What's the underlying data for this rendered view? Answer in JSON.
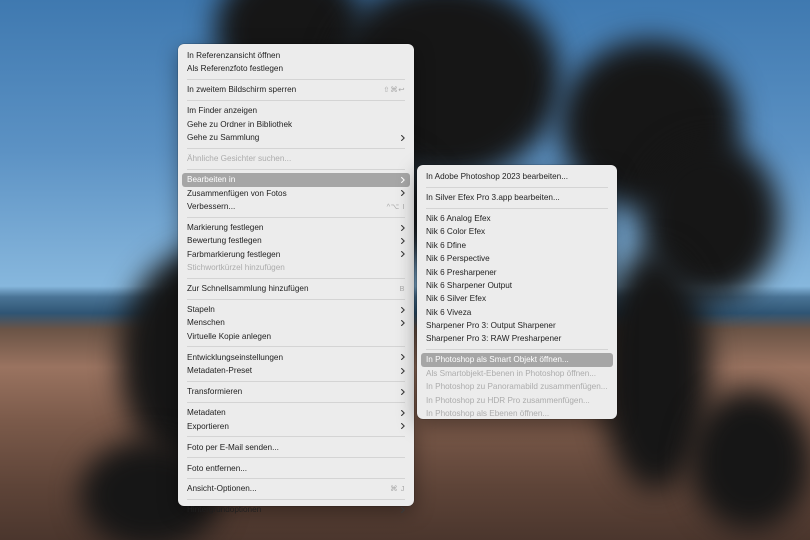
{
  "main_menu": {
    "groups": [
      [
        {
          "label": "In Referenzansicht öffnen"
        },
        {
          "label": "Als Referenzfoto festlegen"
        }
      ],
      [
        {
          "label": "In zweitem Bildschirm sperren",
          "shortcut": "⇧⌘↩"
        }
      ],
      [
        {
          "label": "Im Finder anzeigen"
        },
        {
          "label": "Gehe zu Ordner in Bibliothek"
        },
        {
          "label": "Gehe zu Sammlung",
          "submenu": true
        }
      ],
      [
        {
          "label": "Ähnliche Gesichter suchen...",
          "disabled": true
        }
      ],
      [
        {
          "label": "Bearbeiten in",
          "submenu": true,
          "highlighted": true
        },
        {
          "label": "Zusammenfügen von Fotos",
          "submenu": true
        },
        {
          "label": "Verbessern...",
          "shortcut": "^⌥ I"
        }
      ],
      [
        {
          "label": "Markierung festlegen",
          "submenu": true
        },
        {
          "label": "Bewertung festlegen",
          "submenu": true
        },
        {
          "label": "Farbmarkierung festlegen",
          "submenu": true
        },
        {
          "label": "Stichwortkürzel hinzufügen",
          "disabled": true
        }
      ],
      [
        {
          "label": "Zur Schnellsammlung hinzufügen",
          "shortcut": "B"
        }
      ],
      [
        {
          "label": "Stapeln",
          "submenu": true
        },
        {
          "label": "Menschen",
          "submenu": true
        },
        {
          "label": "Virtuelle Kopie anlegen"
        }
      ],
      [
        {
          "label": "Entwicklungseinstellungen",
          "submenu": true
        },
        {
          "label": "Metadaten-Preset",
          "submenu": true
        }
      ],
      [
        {
          "label": "Transformieren",
          "submenu": true
        }
      ],
      [
        {
          "label": "Metadaten",
          "submenu": true
        },
        {
          "label": "Exportieren",
          "submenu": true
        }
      ],
      [
        {
          "label": "Foto per E-Mail senden..."
        }
      ],
      [
        {
          "label": "Foto entfernen..."
        }
      ],
      [
        {
          "label": "Ansicht-Optionen...",
          "shortcut": "⌘ J"
        }
      ],
      [
        {
          "label": "Hintergrundoptionen",
          "submenu": true
        }
      ]
    ]
  },
  "sub_menu": {
    "groups": [
      [
        {
          "label": "In Adobe Photoshop 2023 bearbeiten..."
        }
      ],
      [
        {
          "label": "In Silver Efex Pro 3.app bearbeiten..."
        }
      ],
      [
        {
          "label": "Nik 6 Analog Efex"
        },
        {
          "label": "Nik 6 Color Efex"
        },
        {
          "label": "Nik 6 Dfine"
        },
        {
          "label": "Nik 6 Perspective"
        },
        {
          "label": "Nik 6 Presharpener"
        },
        {
          "label": "Nik 6 Sharpener Output"
        },
        {
          "label": "Nik 6 Silver Efex"
        },
        {
          "label": "Nik 6 Viveza"
        },
        {
          "label": "Sharpener Pro 3: Output Sharpener"
        },
        {
          "label": "Sharpener Pro 3: RAW Presharpener"
        }
      ],
      [
        {
          "label": "In Photoshop als Smart Objekt öffnen...",
          "highlighted": true
        },
        {
          "label": "Als Smartobjekt-Ebenen in Photoshop öffnen...",
          "disabled": true
        },
        {
          "label": "In Photoshop zu Panoramabild zusammenfügen...",
          "disabled": true
        },
        {
          "label": "In Photoshop zu HDR Pro zusammenfügen...",
          "disabled": true
        },
        {
          "label": "In Photoshop als Ebenen öffnen...",
          "disabled": true
        }
      ]
    ]
  }
}
